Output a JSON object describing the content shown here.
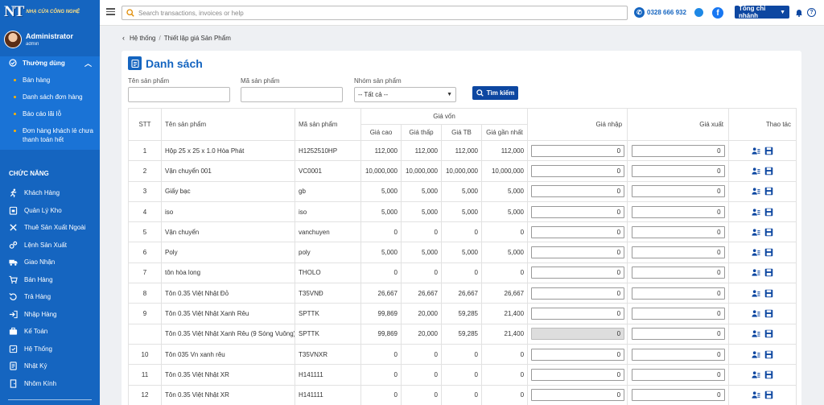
{
  "app": {
    "logo_text": "NT",
    "logo_sub": "NHẠ CỬA CÔNG NGHỆ"
  },
  "user": {
    "name": "Administrator",
    "role": "admin"
  },
  "sidebar": {
    "group_title": "Thường dùng",
    "group_items": [
      {
        "label": "Bán hàng"
      },
      {
        "label": "Danh sách đơn hàng"
      },
      {
        "label": "Báo cáo lãi lỗ"
      },
      {
        "label": "Đơn hàng khách lẻ chưa thanh toán hết"
      }
    ],
    "section_title": "CHỨC NĂNG",
    "items": [
      {
        "label": "Khách Hàng",
        "icon": "running-person-icon"
      },
      {
        "label": "Quản Lý Kho",
        "icon": "warehouse-icon"
      },
      {
        "label": "Thuê Sản Xuất Ngoài",
        "icon": "tools-icon"
      },
      {
        "label": "Lệnh Sản Xuất",
        "icon": "gears-icon"
      },
      {
        "label": "Giao Nhận",
        "icon": "truck-icon"
      },
      {
        "label": "Bán Hàng",
        "icon": "cart-icon"
      },
      {
        "label": "Trả Hàng",
        "icon": "return-icon"
      },
      {
        "label": "Nhập Hàng",
        "icon": "import-icon"
      },
      {
        "label": "Kế Toán",
        "icon": "briefcase-icon"
      },
      {
        "label": "Hệ Thống",
        "icon": "system-icon"
      },
      {
        "label": "Nhật Ký",
        "icon": "log-icon"
      },
      {
        "label": "Nhôm Kính",
        "icon": "door-icon"
      }
    ]
  },
  "topbar": {
    "search_placeholder": "Search transactions, invoices or help",
    "hotline": "0328 666 932",
    "branch": "Tổng chi nhánh"
  },
  "breadcrumb": {
    "parent": "Hệ thống",
    "current": "Thiết lập giá Sản Phẩm"
  },
  "card": {
    "title": "Danh sách",
    "filters": {
      "name_label": "Tên sản phẩm",
      "code_label": "Mã sản phẩm",
      "group_label": "Nhóm sản phẩm",
      "group_value": "-- Tất cả --",
      "search_button": "Tìm kiếm"
    }
  },
  "table": {
    "headers": {
      "stt": "STT",
      "name": "Tên sản phẩm",
      "code": "Mã sản phẩm",
      "cost_group": "Giá vốn",
      "cost_high": "Giá cao",
      "cost_low": "Giá thấp",
      "cost_avg": "Giá TB",
      "cost_recent": "Giá gần nhất",
      "import_price": "Giá nhập",
      "export_price": "Giá xuất",
      "actions": "Thao tác"
    },
    "rows": [
      {
        "stt": "1",
        "name": "Hộp 25 x 25 x 1.0 Hòa Phát",
        "code": "H1252510HP",
        "high": "112,000",
        "low": "112,000",
        "avg": "112,000",
        "recent": "112,000",
        "import": "0",
        "export": "0",
        "import_disabled": false
      },
      {
        "stt": "2",
        "name": "Vận chuyển 001",
        "code": "VC0001",
        "high": "10,000,000",
        "low": "10,000,000",
        "avg": "10,000,000",
        "recent": "10,000,000",
        "import": "0",
        "export": "0",
        "import_disabled": false
      },
      {
        "stt": "3",
        "name": "Giấy bạc",
        "code": "gb",
        "high": "5,000",
        "low": "5,000",
        "avg": "5,000",
        "recent": "5,000",
        "import": "0",
        "export": "0",
        "import_disabled": false
      },
      {
        "stt": "4",
        "name": "iso",
        "code": "iso",
        "high": "5,000",
        "low": "5,000",
        "avg": "5,000",
        "recent": "5,000",
        "import": "0",
        "export": "0",
        "import_disabled": false
      },
      {
        "stt": "5",
        "name": "Vận chuyển",
        "code": "vanchuyen",
        "high": "0",
        "low": "0",
        "avg": "0",
        "recent": "0",
        "import": "0",
        "export": "0",
        "import_disabled": false
      },
      {
        "stt": "6",
        "name": "Poly",
        "code": "poly",
        "high": "5,000",
        "low": "5,000",
        "avg": "5,000",
        "recent": "5,000",
        "import": "0",
        "export": "0",
        "import_disabled": false
      },
      {
        "stt": "7",
        "name": "tôn hòa long",
        "code": "THOLO",
        "high": "0",
        "low": "0",
        "avg": "0",
        "recent": "0",
        "import": "0",
        "export": "0",
        "import_disabled": false
      },
      {
        "stt": "8",
        "name": "Tôn 0.35 Việt Nhật Đỏ",
        "code": "T35VNĐ",
        "high": "26,667",
        "low": "26,667",
        "avg": "26,667",
        "recent": "26,667",
        "import": "0",
        "export": "0",
        "import_disabled": false
      },
      {
        "stt": "9",
        "name": "Tôn 0.35 Việt Nhật Xanh Rêu",
        "code": "SPTTK",
        "high": "99,869",
        "low": "20,000",
        "avg": "59,285",
        "recent": "21,400",
        "import": "0",
        "export": "0",
        "import_disabled": false
      },
      {
        "stt": "",
        "name": "Tôn 0.35 Việt Nhật Xanh Rêu (9 Sóng Vuông)",
        "code": "SPTTK",
        "high": "99,869",
        "low": "20,000",
        "avg": "59,285",
        "recent": "21,400",
        "import": "0",
        "export": "0",
        "import_disabled": true
      },
      {
        "stt": "10",
        "name": "Tôn 035 Vn xanh rêu",
        "code": "T35VNXR",
        "high": "0",
        "low": "0",
        "avg": "0",
        "recent": "0",
        "import": "0",
        "export": "0",
        "import_disabled": false
      },
      {
        "stt": "11",
        "name": "Tôn 0.35 Việt Nhật XR",
        "code": "H141111",
        "high": "0",
        "low": "0",
        "avg": "0",
        "recent": "0",
        "import": "0",
        "export": "0",
        "import_disabled": false
      },
      {
        "stt": "12",
        "name": "Tôn 0.35 Việt Nhật XR",
        "code": "H141111",
        "high": "0",
        "low": "0",
        "avg": "0",
        "recent": "0",
        "import": "0",
        "export": "0",
        "import_disabled": false
      }
    ]
  },
  "colors": {
    "sidebar": "#1565c0",
    "sidebar_group": "#1a73d6",
    "accent": "#0d47a1",
    "dot": "#ffb300"
  }
}
